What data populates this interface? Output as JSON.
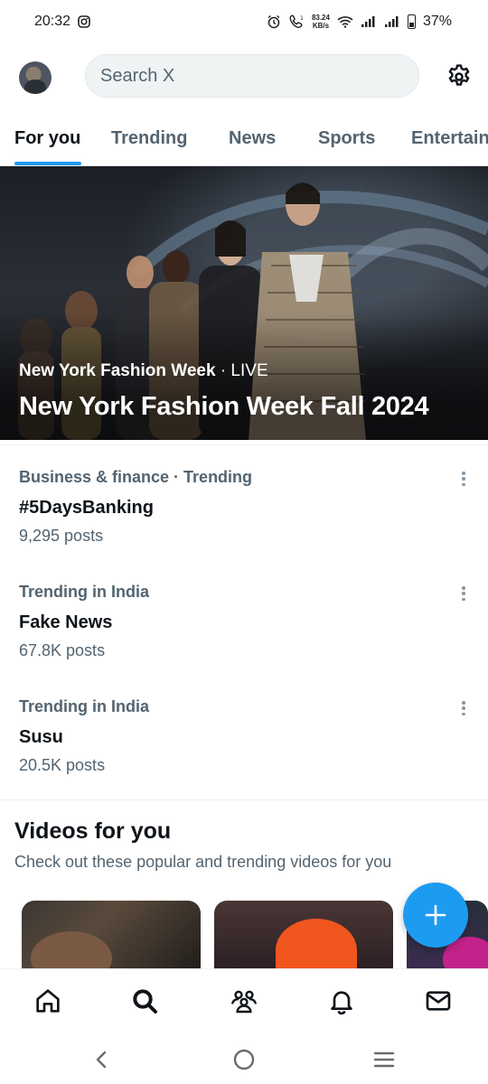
{
  "status_bar": {
    "time": "20:32",
    "net_speed_value": "83.24",
    "net_speed_unit": "KB/s",
    "battery": "37%"
  },
  "header": {
    "search_placeholder": "Search X"
  },
  "tabs": [
    {
      "label": "For you",
      "active": true
    },
    {
      "label": "Trending",
      "active": false
    },
    {
      "label": "News",
      "active": false
    },
    {
      "label": "Sports",
      "active": false
    },
    {
      "label": "Entertainment",
      "active": false
    }
  ],
  "hero": {
    "category": "New York Fashion Week",
    "separator": " · ",
    "status": "LIVE",
    "title": "New York Fashion Week Fall 2024"
  },
  "trends": [
    {
      "meta": "Business & finance · Trending",
      "name": "#5DaysBanking",
      "count": "9,295 posts"
    },
    {
      "meta": "Trending in India",
      "name": "Fake News",
      "count": "67.8K posts"
    },
    {
      "meta": "Trending in India",
      "name": "Susu",
      "count": "20.5K posts"
    }
  ],
  "videos": {
    "title": "Videos for you",
    "subtitle": "Check out these popular and trending videos for you"
  },
  "bottom_nav": [
    {
      "icon": "home-icon"
    },
    {
      "icon": "search-icon"
    },
    {
      "icon": "communities-icon"
    },
    {
      "icon": "notifications-icon"
    },
    {
      "icon": "messages-icon"
    }
  ],
  "colors": {
    "accent": "#1d9bf0",
    "text_primary": "#0f1419",
    "text_secondary": "#536471"
  }
}
